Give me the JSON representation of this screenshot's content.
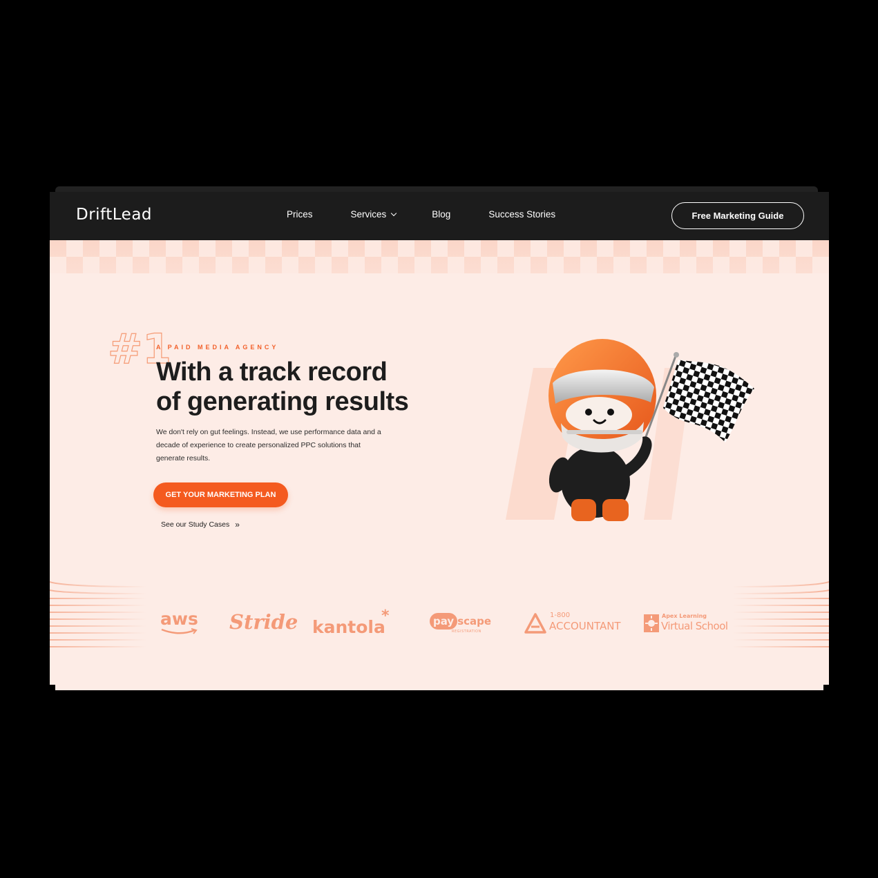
{
  "brand": {
    "name": "DriftLead"
  },
  "nav": {
    "prices": "Prices",
    "services": "Services",
    "blog": "Blog",
    "success": "Success Stories",
    "cta": "Free Marketing Guide"
  },
  "hero": {
    "badge": "#1",
    "eyebrow": "A PAID MEDIA AGENCY",
    "headline_line1": "With a track record",
    "headline_line2": "of generating results",
    "subtext": "We don't rely on gut feelings. Instead, we use performance data and a decade of experience to create personalized PPC solutions that generate results.",
    "primary_cta": "GET YOUR MARKETING PLAN",
    "secondary_link": "See our Study Cases"
  },
  "clients": {
    "aws": "aws",
    "stride": "Stride",
    "kantola": "kantola",
    "payscape_pay": "pay",
    "payscape_scape": "scape",
    "payscape_sub": "REGISTRATION",
    "accountant_top": "1-800",
    "accountant_main": "ACCOUNTANT",
    "apex_top": "Apex Learning",
    "apex_main": "Virtual School"
  },
  "colors": {
    "accent": "#f45a1f",
    "background": "#fdece6",
    "navbar": "#1c1c1c",
    "logo_tint": "#f49a78"
  },
  "icons": [
    "chevron-down-icon",
    "double-chevron-right-icon",
    "checkered-flag-icon"
  ]
}
